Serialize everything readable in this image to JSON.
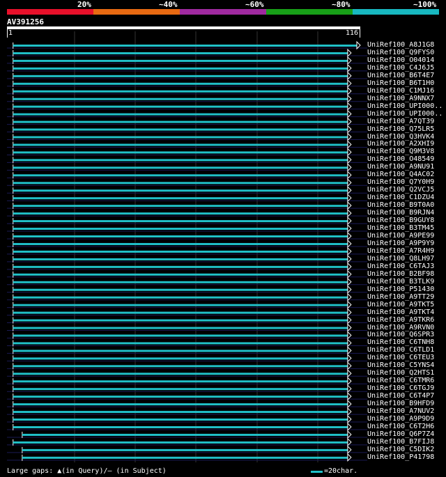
{
  "legend": {
    "segments": [
      {
        "label": "20%",
        "color": "#e8102a"
      },
      {
        "label": "~40%",
        "color": "#e86a12"
      },
      {
        "label": "~60%",
        "color": "#a02aa0"
      },
      {
        "label": "~80%",
        "color": "#18a018"
      },
      {
        "label": "~100%",
        "color": "#18b8c0"
      }
    ]
  },
  "query": {
    "id": "AV391256",
    "start": "1",
    "end": "116"
  },
  "colors": {
    "hit": "#20c0c8",
    "guide": "#1a1a55",
    "arrow": "#ffffff"
  },
  "hits": [
    {
      "label": "UniRef100_A8J1G8",
      "start": 2,
      "end": 116
    },
    {
      "label": "UniRef100_Q9FYS0",
      "start": 2,
      "end": 113
    },
    {
      "label": "UniRef100_O04014",
      "start": 2,
      "end": 113
    },
    {
      "label": "UniRef100_C4J6J5",
      "start": 2,
      "end": 113
    },
    {
      "label": "UniRef100_B6T4E7",
      "start": 2,
      "end": 113
    },
    {
      "label": "UniRef100_B6T1H0",
      "start": 2,
      "end": 113
    },
    {
      "label": "UniRef100_C1MJ16",
      "start": 2,
      "end": 113
    },
    {
      "label": "UniRef100_A9NNX7",
      "start": 2,
      "end": 113
    },
    {
      "label": "UniRef100_UPI000..",
      "start": 2,
      "end": 113
    },
    {
      "label": "UniRef100_UPI000..",
      "start": 2,
      "end": 113
    },
    {
      "label": "UniRef100_A7QT39",
      "start": 2,
      "end": 113
    },
    {
      "label": "UniRef100_Q75LR5",
      "start": 2,
      "end": 113
    },
    {
      "label": "UniRef100_Q3HVK4",
      "start": 2,
      "end": 113
    },
    {
      "label": "UniRef100_A2XHI9",
      "start": 2,
      "end": 113
    },
    {
      "label": "UniRef100_Q9M3V8",
      "start": 2,
      "end": 113
    },
    {
      "label": "UniRef100_O48549",
      "start": 2,
      "end": 113
    },
    {
      "label": "UniRef100_A9NU91",
      "start": 2,
      "end": 113
    },
    {
      "label": "UniRef100_Q4AC02",
      "start": 2,
      "end": 113
    },
    {
      "label": "UniRef100_Q7Y0H9",
      "start": 2,
      "end": 113
    },
    {
      "label": "UniRef100_Q2VCJ5",
      "start": 2,
      "end": 113
    },
    {
      "label": "UniRef100_C1DZU4",
      "start": 2,
      "end": 113
    },
    {
      "label": "UniRef100_B9T0A0",
      "start": 2,
      "end": 113
    },
    {
      "label": "UniRef100_B9RJN4",
      "start": 2,
      "end": 113
    },
    {
      "label": "UniRef100_B9GUY8",
      "start": 2,
      "end": 113
    },
    {
      "label": "UniRef100_B3TM45",
      "start": 2,
      "end": 113
    },
    {
      "label": "UniRef100_A9PE99",
      "start": 2,
      "end": 113
    },
    {
      "label": "UniRef100_A9P9Y9",
      "start": 2,
      "end": 113
    },
    {
      "label": "UniRef100_A7R4H9",
      "start": 2,
      "end": 113
    },
    {
      "label": "UniRef100_Q8LH97",
      "start": 2,
      "end": 113
    },
    {
      "label": "UniRef100_C6TAJ3",
      "start": 2,
      "end": 113
    },
    {
      "label": "UniRef100_B2BF98",
      "start": 2,
      "end": 113
    },
    {
      "label": "UniRef100_B3TLK9",
      "start": 2,
      "end": 113
    },
    {
      "label": "UniRef100_P51430",
      "start": 2,
      "end": 113
    },
    {
      "label": "UniRef100_A9TT29",
      "start": 2,
      "end": 113
    },
    {
      "label": "UniRef100_A9TKT5",
      "start": 2,
      "end": 113
    },
    {
      "label": "UniRef100_A9TKT4",
      "start": 2,
      "end": 113
    },
    {
      "label": "UniRef100_A9TKR6",
      "start": 2,
      "end": 113
    },
    {
      "label": "UniRef100_A9RVN0",
      "start": 2,
      "end": 113
    },
    {
      "label": "UniRef100_Q6SPR3",
      "start": 2,
      "end": 113
    },
    {
      "label": "UniRef100_C6TNH8",
      "start": 2,
      "end": 113
    },
    {
      "label": "UniRef100_C6TLD1",
      "start": 2,
      "end": 113
    },
    {
      "label": "UniRef100_C6TEU3",
      "start": 2,
      "end": 113
    },
    {
      "label": "UniRef100_C5YNS4",
      "start": 2,
      "end": 113
    },
    {
      "label": "UniRef100_Q2HTS1",
      "start": 2,
      "end": 113
    },
    {
      "label": "UniRef100_C6TMR6",
      "start": 2,
      "end": 113
    },
    {
      "label": "UniRef100_C6TGJ9",
      "start": 2,
      "end": 113
    },
    {
      "label": "UniRef100_C6T4P7",
      "start": 2,
      "end": 113
    },
    {
      "label": "UniRef100_B9HFD9",
      "start": 2,
      "end": 113
    },
    {
      "label": "UniRef100_A7NUV2",
      "start": 2,
      "end": 113
    },
    {
      "label": "UniRef100_A9P9D9",
      "start": 2,
      "end": 113
    },
    {
      "label": "UniRef100_C6T2H6",
      "start": 2,
      "end": 113
    },
    {
      "label": "UniRef100_Q6P7Z4",
      "start": 5,
      "end": 113
    },
    {
      "label": "UniRef100_B7FIJ8",
      "start": 2,
      "end": 113
    },
    {
      "label": "UniRef100_C5DIK2",
      "start": 5,
      "end": 113
    },
    {
      "label": "UniRef100_P41798",
      "start": 5,
      "end": 113
    }
  ],
  "footer": {
    "gaps_text": "Large gaps: ▲(in Query)/– (in Subject)",
    "scale_text": "=20char."
  }
}
